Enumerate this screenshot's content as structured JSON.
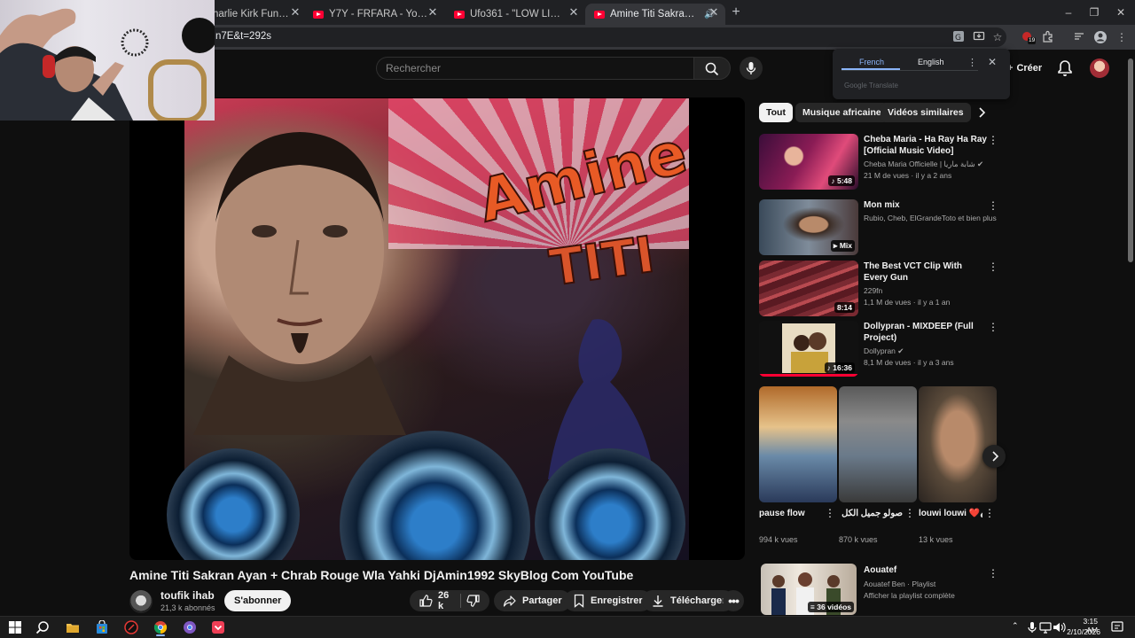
{
  "browser": {
    "tabs": [
      {
        "title": "harlie Kirk Funk (slowe",
        "active": false
      },
      {
        "title": "Y7Y - FRFARA - YouTube",
        "active": false
      },
      {
        "title": "Ufo361 - \"LOW LIFE\" feat. RIN -",
        "active": false
      },
      {
        "title": "Amine Titi Sakran Ayan + C",
        "active": true
      }
    ],
    "url": "n7E&t=292s",
    "extension_badge": "19"
  },
  "youtube_header": {
    "search_placeholder": "Rechercher",
    "create_label": "Créer"
  },
  "translate_popup": {
    "tab_french": "French",
    "tab_english": "English",
    "brand": "Google Translate"
  },
  "player": {
    "cover_text_1": "Amine",
    "cover_text_2": "TITI"
  },
  "video": {
    "title": "Amine Titi Sakran Ayan + Chrab Rouge Wla Yahki DjAmin1992 SkyBlog Com YouTube",
    "channel_name": "toufik ihab",
    "subscribers": "21,3 k abonnés",
    "subscribe_label": "S'abonner",
    "likes": "26 k",
    "share_label": "Partager",
    "save_label": "Enregistrer",
    "download_label": "Télécharger"
  },
  "sidebar": {
    "chips": [
      "Tout",
      "Musique africaine",
      "Vidéos similaires"
    ],
    "recommendations": [
      {
        "title": "Cheba Maria - Ha Ray Ha Ray [Official Music Video]",
        "channel": "Cheba Maria Officielle | شابة ماريا",
        "meta": "21 M de vues · il y a 2 ans",
        "duration": "5:48",
        "verified": true
      },
      {
        "title": "Mon mix",
        "channel": "Rubio, Cheb, ElGrandeToto et bien plus e...",
        "meta": "",
        "duration": "Mix",
        "verified": false
      },
      {
        "title": "The Best VCT Clip With Every Gun",
        "channel": "229fn",
        "meta": "1,1 M de vues · il y a 1 an",
        "duration": "8:14",
        "verified": false
      },
      {
        "title": "Dollypran - MIXDEEP (Full Project)",
        "channel": "Dollypran",
        "meta": "8,1 M de vues · il y a 3 ans",
        "duration": "16:36",
        "verified": true
      }
    ],
    "shorts": [
      {
        "title": "pause flow",
        "views": "994 k vues"
      },
      {
        "title": "صولو جميل الكل 🔥😱 بث عنه",
        "views": "870 k vues"
      },
      {
        "title": "louwi louwi ❤️🩹🚦#ra...",
        "views": "13 k vues"
      }
    ],
    "playlist": {
      "title": "Aouatef",
      "channel": "Aouatef Ben · Playlist",
      "action": "Afficher la playlist complète",
      "count": "36 vidéos"
    }
  },
  "taskbar": {
    "time": "3:15 AM",
    "date": "2/10/2026"
  },
  "colors": {
    "youtube_red": "#ff0033",
    "background": "#0f0f0f",
    "chip_bg": "#272727",
    "link_blue": "#8ab4f8"
  }
}
